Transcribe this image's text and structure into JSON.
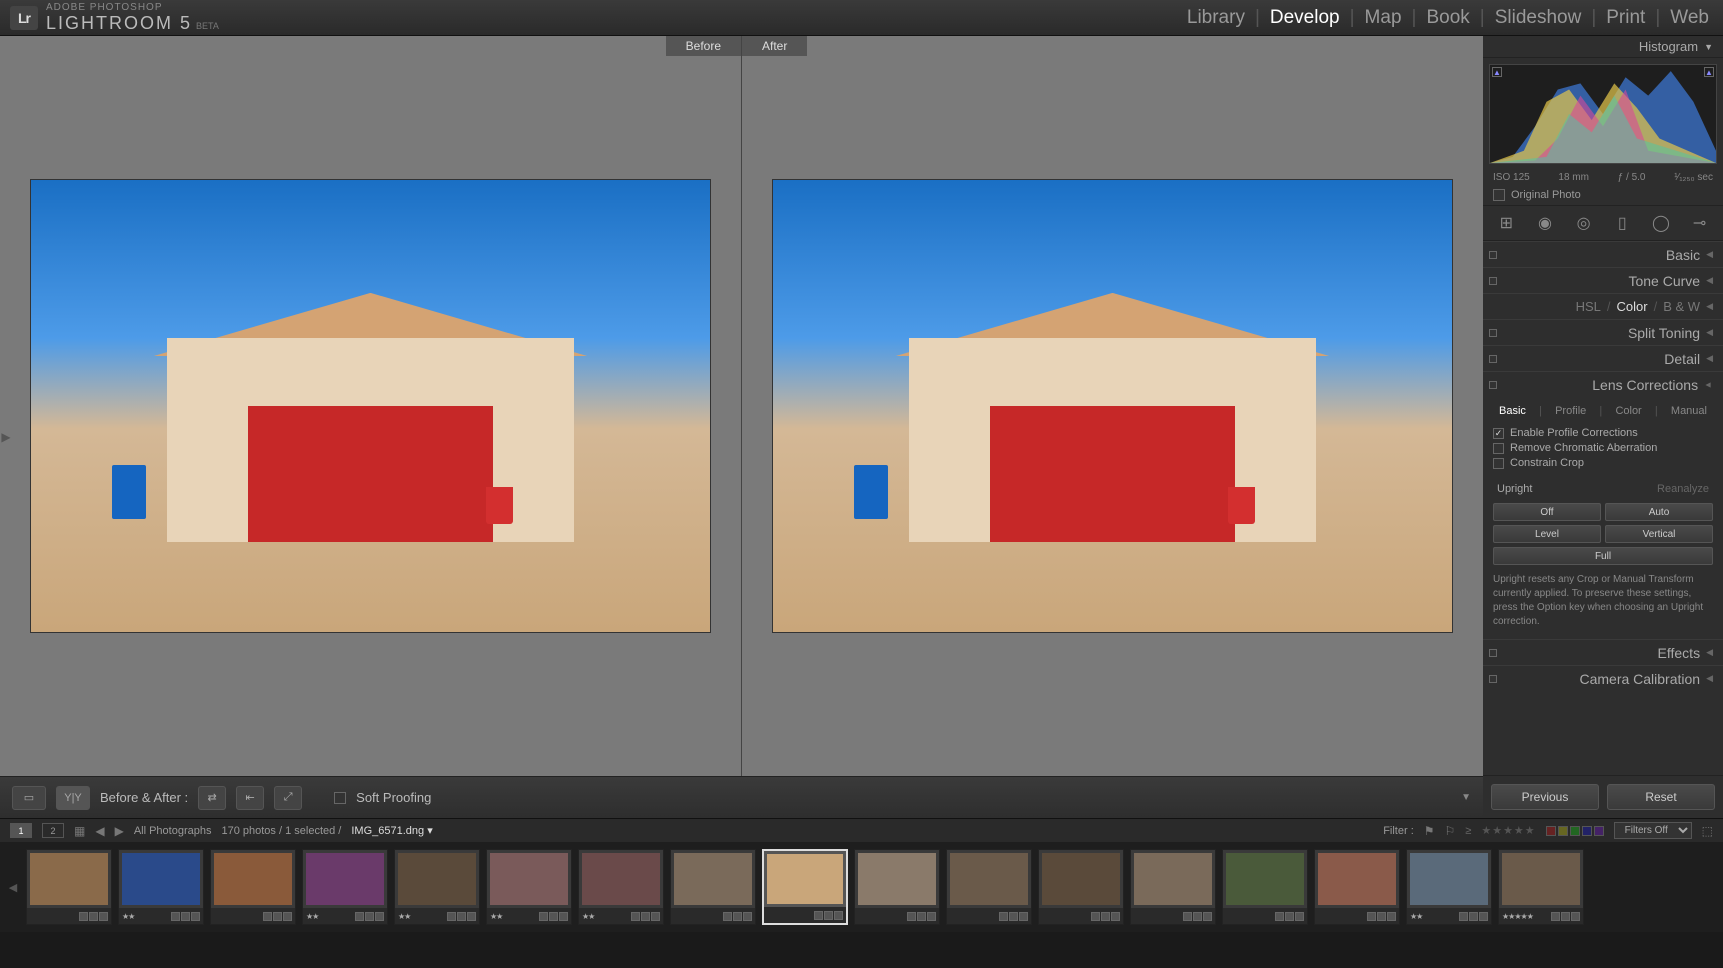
{
  "brand": {
    "small": "ADOBE PHOTOSHOP",
    "big": "LIGHTROOM 5",
    "beta": "BETA",
    "logo": "Lr"
  },
  "modules": [
    "Library",
    "Develop",
    "Map",
    "Book",
    "Slideshow",
    "Print",
    "Web"
  ],
  "active_module": "Develop",
  "compare": {
    "before": "Before",
    "after": "After"
  },
  "preview_toolbar": {
    "ba_label": "Before & After :",
    "soft_proof": "Soft Proofing"
  },
  "right": {
    "histogram_label": "Histogram",
    "histo_info": {
      "iso": "ISO 125",
      "focal": "18 mm",
      "aperture": "ƒ / 5.0",
      "shutter": "¹⁄₁₂₅₀ sec"
    },
    "original": "Original Photo",
    "sections": {
      "basic": "Basic",
      "tone_curve": "Tone Curve",
      "hsl": "HSL",
      "color": "Color",
      "bw": "B & W",
      "split_toning": "Split Toning",
      "detail": "Detail",
      "lens": "Lens Corrections",
      "effects": "Effects",
      "camera_cal": "Camera Calibration"
    },
    "lens": {
      "tabs": [
        "Basic",
        "Profile",
        "Color",
        "Manual"
      ],
      "active_tab": "Basic",
      "chk1": "Enable Profile Corrections",
      "chk2": "Remove Chromatic Aberration",
      "chk3": "Constrain Crop",
      "upright": "Upright",
      "reanalyze": "Reanalyze",
      "buttons": [
        "Off",
        "Auto",
        "Level",
        "Vertical",
        "Full"
      ],
      "help": "Upright resets any Crop or Manual Transform currently applied. To preserve these settings, press the Option key when choosing an Upright correction."
    },
    "previous": "Previous",
    "reset": "Reset"
  },
  "filterbar": {
    "pages": [
      "1",
      "2"
    ],
    "source": "All Photographs",
    "count": "170 photos / 1 selected /",
    "filename": "IMG_6571.dng",
    "filter_label": "Filter :",
    "filters_off": "Filters Off"
  },
  "filmstrip": {
    "selected_index": 8,
    "thumbs": [
      {
        "stars": "",
        "color": "#8a6a4a"
      },
      {
        "stars": "★★",
        "color": "#2a4a8a"
      },
      {
        "stars": "",
        "color": "#8a5a3a"
      },
      {
        "stars": "★★",
        "color": "#6a3a6a"
      },
      {
        "stars": "★★",
        "color": "#5a4a3a"
      },
      {
        "stars": "★★",
        "color": "#7a5a5a"
      },
      {
        "stars": "★★",
        "color": "#6a4a4a"
      },
      {
        "stars": "",
        "color": "#7a6a5a"
      },
      {
        "stars": "",
        "color": "#c9a67a"
      },
      {
        "stars": "",
        "color": "#8a7a6a"
      },
      {
        "stars": "",
        "color": "#6a5a4a"
      },
      {
        "stars": "",
        "color": "#5a4a3a"
      },
      {
        "stars": "",
        "color": "#7a6a5a"
      },
      {
        "stars": "",
        "color": "#4a5a3a"
      },
      {
        "stars": "",
        "color": "#8a5a4a"
      },
      {
        "stars": "★★",
        "color": "#5a6a7a"
      },
      {
        "stars": "★★★★★",
        "color": "#6a5a4a"
      }
    ]
  }
}
